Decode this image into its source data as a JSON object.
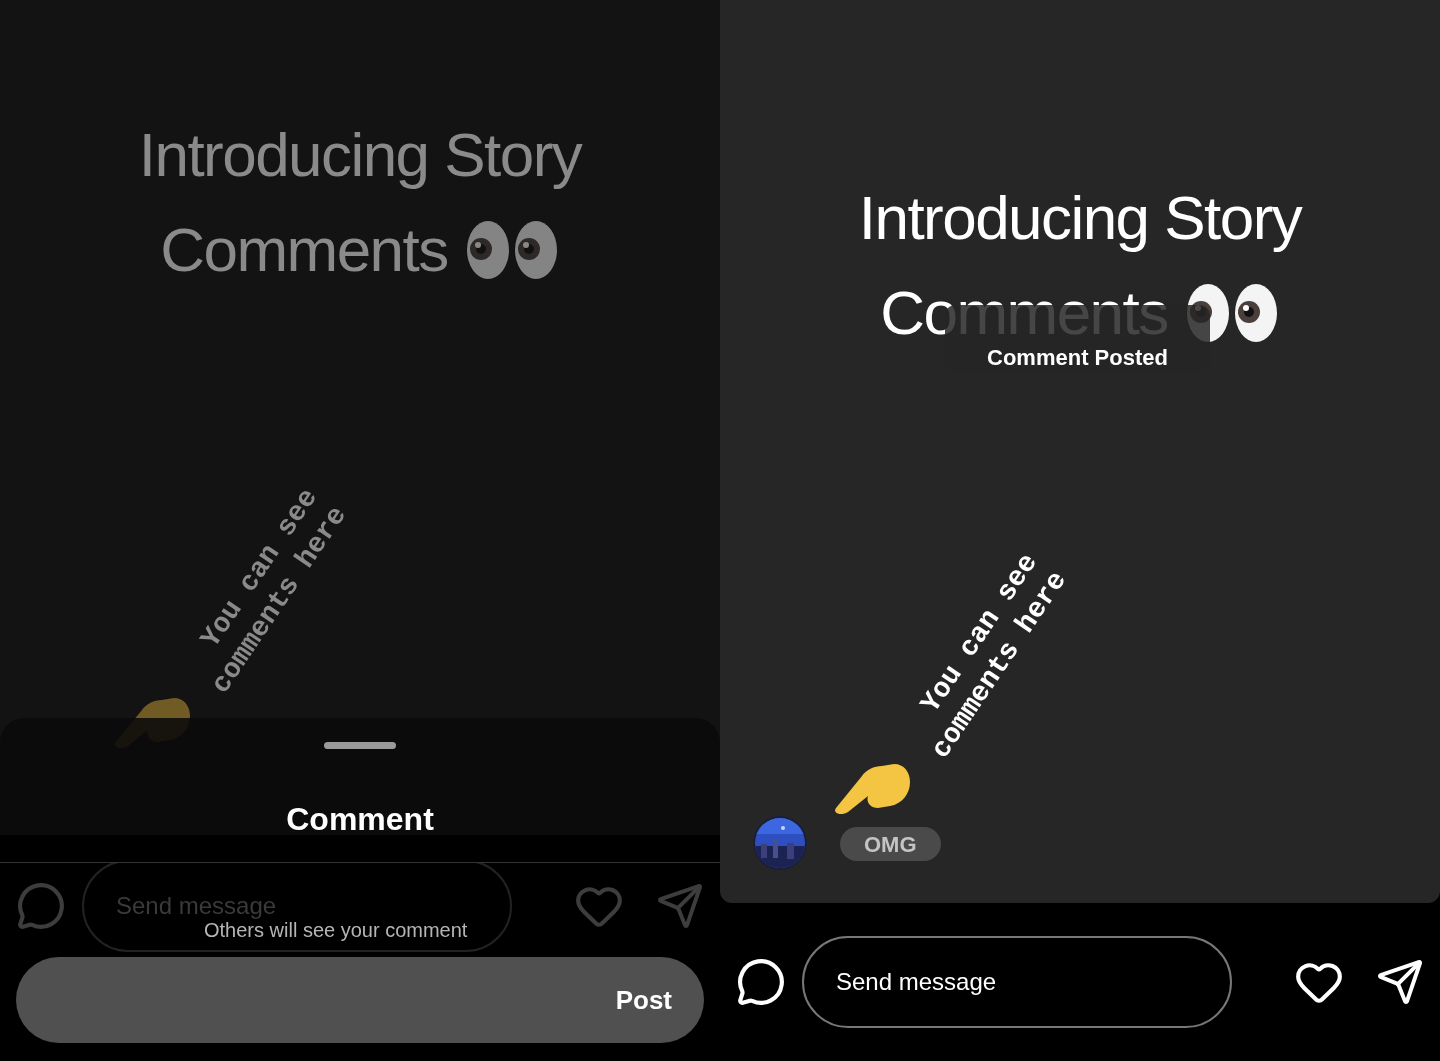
{
  "panels": [
    {
      "kind": "commenting",
      "story": {
        "title_lines": [
          "Introducing Story",
          "Comments"
        ],
        "rotated_lines": [
          "You can see",
          "comments here"
        ]
      },
      "sheet": {
        "title": "Comment",
        "hint": "Others will see your comment",
        "button": "Post"
      },
      "composer": {
        "placeholder": "Send message"
      }
    },
    {
      "kind": "posted",
      "story": {
        "title_lines": [
          "Introducing Story",
          "Comments"
        ],
        "rotated_lines": [
          "You can see",
          "comments here"
        ]
      },
      "toast": "Comment Posted",
      "comments": [
        {
          "text": "OMG"
        }
      ],
      "composer": {
        "placeholder": "Send message"
      }
    }
  ]
}
